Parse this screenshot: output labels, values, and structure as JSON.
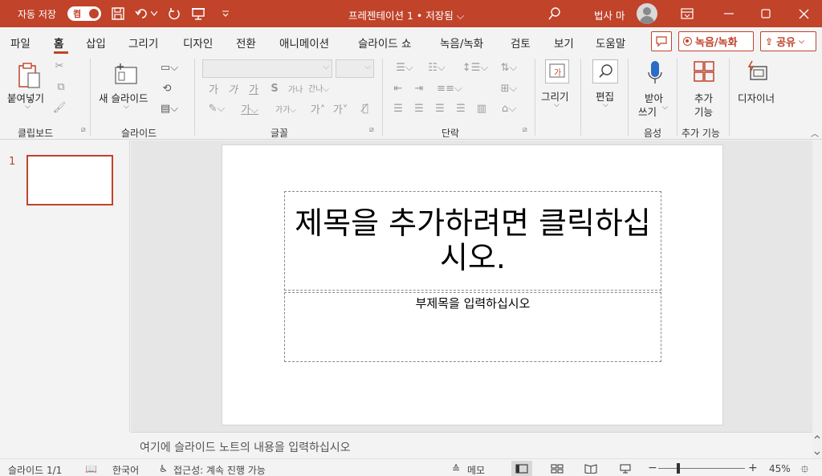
{
  "titlebar": {
    "autosave_label": "자동 저장",
    "autosave_state": "켬",
    "document_title": "프레젠테이션 1 • 저장됨 ⌵",
    "user_name": "법사 마",
    "accent": "#c0432a"
  },
  "menu_tabs": [
    "파일",
    "홈",
    "삽입",
    "그리기",
    "디자인",
    "전환",
    "애니메이션",
    "슬라이드 쇼",
    "녹음/녹화",
    "검토",
    "보기",
    "도움말"
  ],
  "active_tab": "홈",
  "ribbon_right": {
    "record_label": "녹음/녹화",
    "share_label": "공유"
  },
  "ribbon": {
    "clipboard": {
      "paste": "붙여넣기",
      "group": "클립보드"
    },
    "slides": {
      "new_slide": "새 슬라이드",
      "group": "슬라이드"
    },
    "font": {
      "group": "글꼴"
    },
    "paragraph": {
      "group": "단락"
    },
    "drawing": {
      "label": "그리기"
    },
    "editing": {
      "label": "편집"
    },
    "voice": {
      "label1": "받아",
      "label2": "쓰기",
      "group": "음성"
    },
    "addins": {
      "label1": "추가",
      "label2": "기능",
      "group": "추가 기능"
    },
    "designer": {
      "label": "디자이너"
    }
  },
  "thumbnails": {
    "slide_number": "1"
  },
  "slide": {
    "title_placeholder": "제목을 추가하려면 클릭하십시오.",
    "subtitle_placeholder": "부제목을 입력하십시오"
  },
  "notes_placeholder": "여기에 슬라이드 노트의 내용을 입력하십시오",
  "status": {
    "slide_count": "슬라이드 1/1",
    "language": "한국어",
    "accessibility": "접근성: 계속 진행 가능",
    "notes_button": "메모",
    "zoom": "45%"
  }
}
